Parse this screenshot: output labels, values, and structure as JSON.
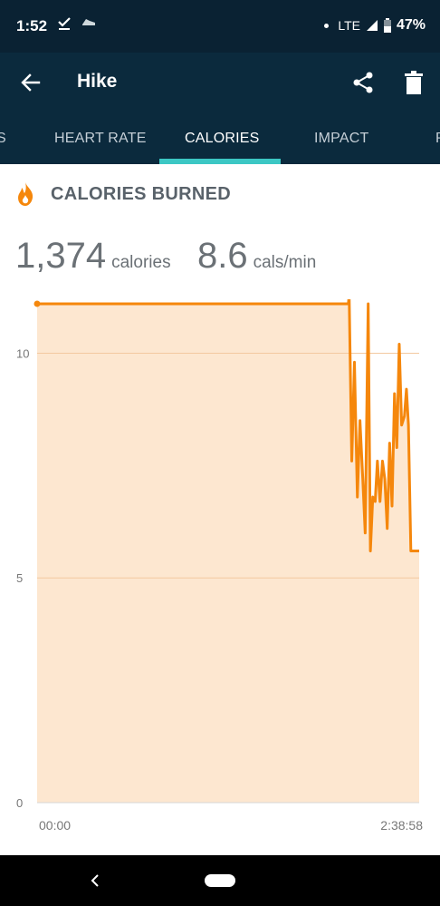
{
  "status": {
    "time": "1:52",
    "network": "LTE",
    "battery": "47%"
  },
  "appbar": {
    "title": "Hike"
  },
  "tabs": [
    {
      "label": "S"
    },
    {
      "label": "HEART RATE"
    },
    {
      "label": "CALORIES"
    },
    {
      "label": "IMPACT"
    },
    {
      "label": "P"
    }
  ],
  "section": {
    "title": "CALORIES BURNED"
  },
  "stats": {
    "calories_value": "1,374",
    "calories_unit": "calories",
    "rate_value": "8.6",
    "rate_unit": "cals/min"
  },
  "colors": {
    "line": "#f5870c",
    "fill": "#fde7d0",
    "accent": "#3cc7c4",
    "header": "#0b2a3d"
  },
  "chart_data": {
    "type": "area",
    "ylim": [
      0,
      11.2
    ],
    "yticks": [
      0,
      5,
      10
    ],
    "xlim": [
      0,
      9538
    ],
    "xtick_labels": [
      "00:00",
      "2:38:58"
    ],
    "x": [
      0,
      7770,
      7790,
      7855,
      7922,
      7995,
      8060,
      8130,
      8190,
      8265,
      8320,
      8380,
      8440,
      8495,
      8560,
      8622,
      8680,
      8740,
      8800,
      8860,
      8922,
      8980,
      9040,
      9100,
      9170,
      9220,
      9270,
      9330,
      9380,
      9440,
      9538
    ],
    "y": [
      11.1,
      11.1,
      11.3,
      7.6,
      9.8,
      6.8,
      8.5,
      7.2,
      6.0,
      11.1,
      5.6,
      6.8,
      6.7,
      7.6,
      6.7,
      7.6,
      7.2,
      6.1,
      8.0,
      6.6,
      9.1,
      7.9,
      10.2,
      8.4,
      8.6,
      9.2,
      8.4,
      5.6,
      5.6,
      5.6,
      5.6
    ]
  }
}
